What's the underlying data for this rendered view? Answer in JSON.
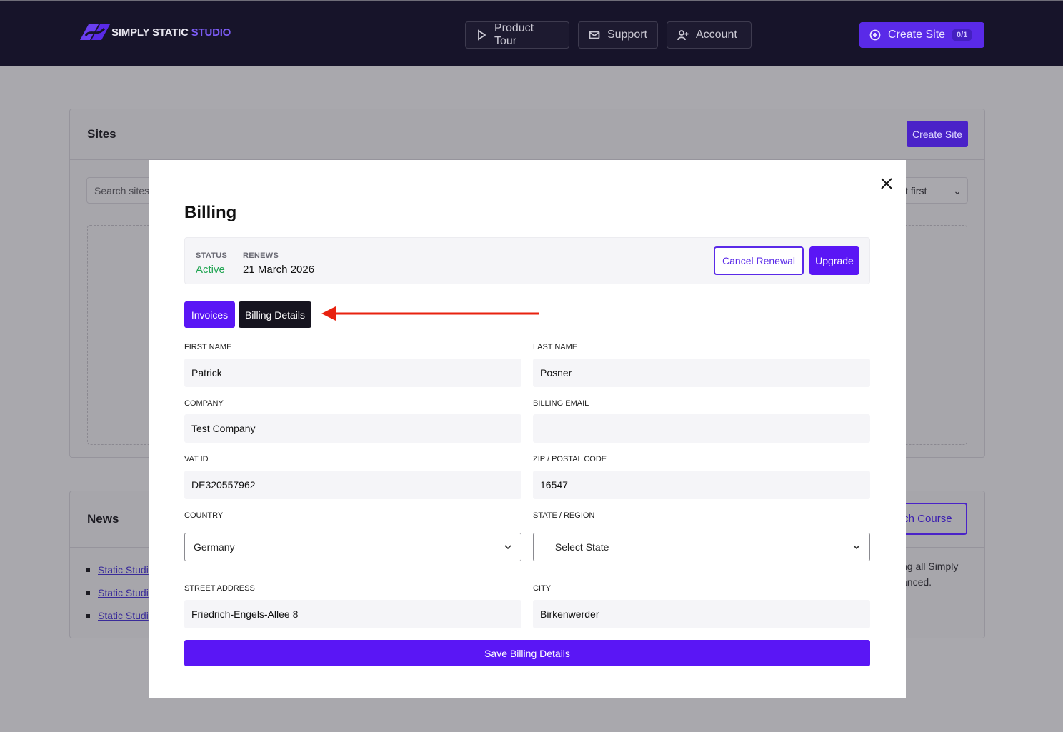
{
  "header": {
    "logo_main": "SIMPLY STATIC",
    "logo_accent": "STUDIO",
    "nav": {
      "product_tour": "Product Tour",
      "support": "Support",
      "account": "Account"
    },
    "create_site": "Create Site",
    "create_site_count": "0/1"
  },
  "background": {
    "sites_title": "Sites",
    "create_site_button": "Create Site",
    "search_placeholder": "Search sites...",
    "sort_visible": "t first",
    "news_title": "News",
    "news_links": [
      "Static Studi",
      "Static Studi",
      "Static Studi"
    ],
    "course_button_visible": "tch Course",
    "news_text_line1": "ng all Simply",
    "news_text_line2": "anced."
  },
  "modal": {
    "title": "Billing",
    "status_label": "STATUS",
    "status_value": "Active",
    "renews_label": "RENEWS",
    "renews_value": "21 March 2026",
    "cancel_renewal": "Cancel Renewal",
    "upgrade": "Upgrade",
    "tabs": {
      "invoices": "Invoices",
      "billing_details": "Billing Details"
    },
    "fields": {
      "first_name": {
        "label": "FIRST NAME",
        "value": "Patrick"
      },
      "last_name": {
        "label": "LAST NAME",
        "value": "Posner"
      },
      "company": {
        "label": "COMPANY",
        "value": "Test Company"
      },
      "billing_email": {
        "label": "BILLING EMAIL",
        "value": ""
      },
      "vat_id": {
        "label": "VAT ID",
        "value": "DE320557962"
      },
      "zip": {
        "label": "ZIP / POSTAL CODE",
        "value": "16547"
      },
      "country": {
        "label": "COUNTRY",
        "value": "Germany"
      },
      "state": {
        "label": "STATE / REGION",
        "value": "— Select State —"
      },
      "street": {
        "label": "STREET ADDRESS",
        "value": "Friedrich-Engels-Allee 8"
      },
      "city": {
        "label": "CITY",
        "value": "Birkenwerder"
      }
    },
    "save_button": "Save Billing Details"
  },
  "colors": {
    "brand": "#5a16f5",
    "header_bg": "#17142a",
    "active_status": "#22a553",
    "annotation_arrow": "#e8220f"
  }
}
